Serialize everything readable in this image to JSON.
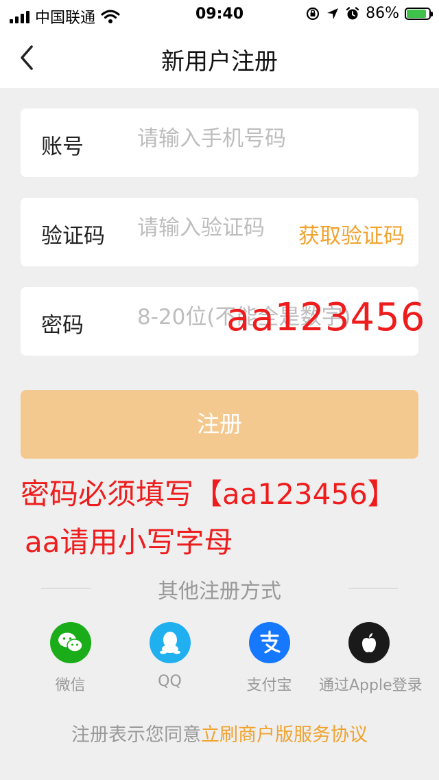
{
  "status_bar": {
    "carrier": "中国联通",
    "time": "09:40",
    "battery": "86%",
    "battery_level": 0.86
  },
  "header": {
    "title": "新用户注册"
  },
  "form": {
    "account": {
      "label": "账号",
      "placeholder": "请输入手机号码"
    },
    "code": {
      "label": "验证码",
      "placeholder": "请输入验证码",
      "get_code": "获取验证码"
    },
    "password": {
      "label": "密码",
      "placeholder": "8-20位(不能全是数字)",
      "overlay": "aa123456"
    },
    "submit": "注册"
  },
  "notes": {
    "line1": "密码必须填写【aa123456】",
    "line2": "aa请用小写字母"
  },
  "other_methods": {
    "title": "其他注册方式",
    "items": [
      {
        "label": "微信",
        "icon": "wechat-icon",
        "color": "#1aad19"
      },
      {
        "label": "QQ",
        "icon": "qq-icon",
        "color": "#20b0f0"
      },
      {
        "label": "支付宝",
        "icon": "alipay-icon",
        "color": "#1677ff"
      },
      {
        "label": "通过Apple登录",
        "icon": "apple-icon",
        "color": "#1a1a1a"
      }
    ]
  },
  "agreement": {
    "prefix": "注册表示您同意",
    "link": "立刷商户版服务协议"
  },
  "colors": {
    "accent": "#f0a32f",
    "submit_bg": "#f4c98f",
    "note_red": "#ee1c1c"
  }
}
